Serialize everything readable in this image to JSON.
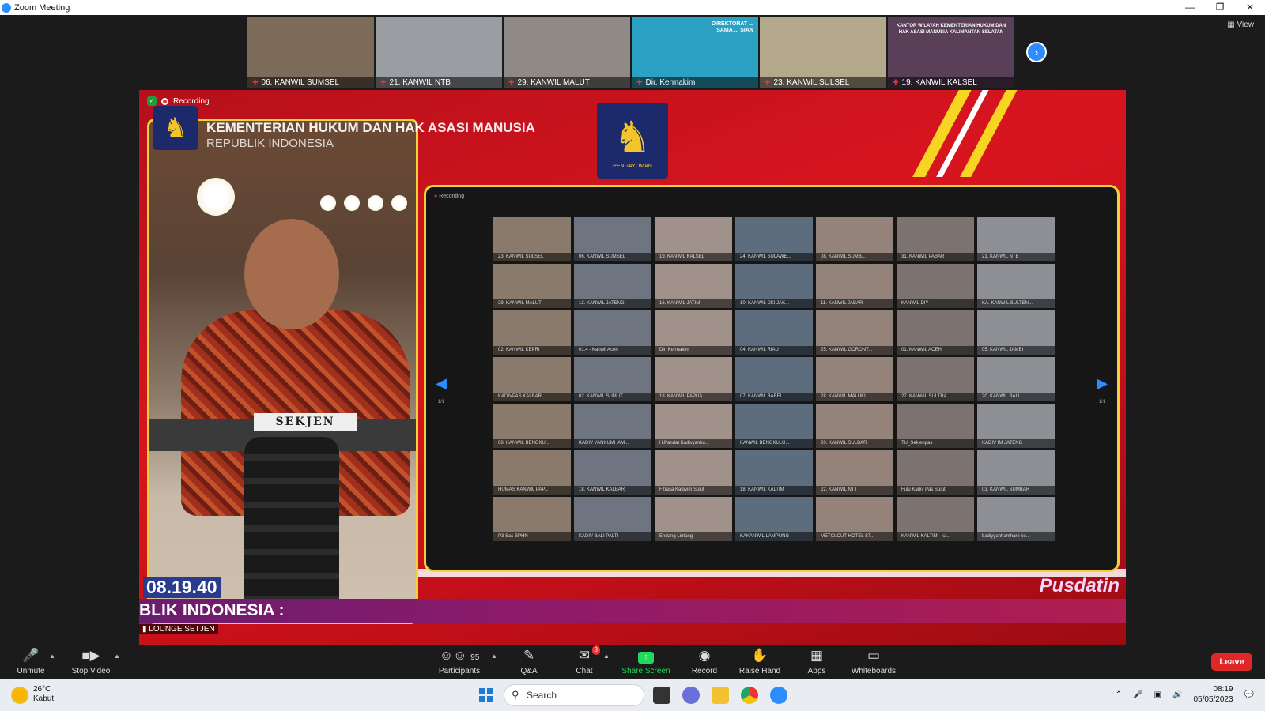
{
  "window": {
    "title": "Zoom Meeting"
  },
  "strip": {
    "thumbs": [
      {
        "label": "06. KANWIL SUMSEL",
        "color": "#7d6b5a"
      },
      {
        "label": "21. KANWIL NTB",
        "color": "#9a9ea3"
      },
      {
        "label": "29. KANWIL MALUT",
        "color": "#8f8a85"
      },
      {
        "label": "Dir. Kermakim",
        "color": "#2ba2c4"
      },
      {
        "label": "23. KANWIL SULSEL",
        "color": "#b3a88c"
      },
      {
        "label": "19. KANWIL KALSEL",
        "color": "#5a3f59"
      }
    ],
    "thumb4_overlay": "DIREKTORAT ... SAMA ... SIAN",
    "thumb6_overlay": "KANTOR WILAYAH KEMENTERIAN HUKUM DAN HAK ASASI MANUSIA KALIMANTAN SELATAN",
    "view_label": "View"
  },
  "share": {
    "recording_label": "Recording",
    "ministry_line1": "KEMENTERIAN HUKUM DAN HAK ASASI MANUSIA",
    "ministry_line2": "REPUBLIK INDONESIA",
    "emblem_caption": "PENGAYOMAN",
    "name_plate": "SEKJEN",
    "clock": "08.19.40",
    "ticker": "BLIK INDONESIA :",
    "room_name": "LOUNGE SETJEN",
    "logo": "Pusdatin",
    "inner_recording": "Recording",
    "inner_page_left": "1/1",
    "inner_page_right": "1/1",
    "grid": [
      "23. KANWIL SULSEL",
      "06. KANWIL SUMSEL",
      "19. KANWIL KALSEL",
      "24. KANWIL SULAWE...",
      "08. KANWIL SUMB...",
      "31. KANWIL PABAR",
      "21. KANWIL NTB",
      "29. KANWIL MALUT",
      "13. KANWIL JATENG",
      "16. KANWIL JATIM",
      "10. KANWIL DKI JAK...",
      "11. KANWIL JABAR",
      "KANWIL DIY",
      "KA. KANWIL SULTEN...",
      "02. KANWIL KEPRI",
      "01.4 - Kanwil Aceh",
      "Dir. Kermakim",
      "04. KANWIL RIAU",
      "25. KANWIL GORONT...",
      "01. KANWIL ACEH",
      "05. KANWIL JAMBI",
      "KADIVPAS KALBAR...",
      "02. KANWIL SUMUT",
      "18. KANWIL PAPUA",
      "07. KANWIL BABEL",
      "28. KANWIL MALUKU",
      "27. KANWIL SULTRA",
      "20. KANWIL BALI",
      "08. KANWIL BENGKU...",
      "KADIV YANKUMHAM...",
      "H.Pandat Kadivyanku...",
      "KANWIL BENGKULU...",
      "20. KANWIL SULBAR",
      "TU_Sekjenpas",
      "KADIV IM JATENG",
      "HUMAS KANWIL PAP...",
      "18. KANWIL KALBAR",
      "Fitrasa Kadivim Sulut",
      "18. KANWIL KALTIM",
      "22. KANWIL NTT",
      "Fulu Kadiv Pas Sulut",
      "03. KANWIL SUMBAR",
      "P3 Sas BPHN",
      "KADIV BALI PALTI",
      "Endang Lintang",
      "KAKANWIL LAMPUNG",
      "METCLOUT HOTEL ST...",
      "KANWIL KALTIM - ka...",
      "badiyyanhamhare ke..."
    ]
  },
  "toolbar": {
    "unmute": "Unmute",
    "stop_video": "Stop Video",
    "participants": "Participants",
    "participants_count": "95",
    "qa": "Q&A",
    "chat": "Chat",
    "chat_badge": "8",
    "share_screen": "Share Screen",
    "record": "Record",
    "raise_hand": "Raise Hand",
    "apps": "Apps",
    "whiteboards": "Whiteboards",
    "leave": "Leave",
    "share_color": "#23d959"
  },
  "taskbar": {
    "temperature": "26°C",
    "weather_text": "Kabut",
    "search_label": "Search",
    "time": "08:19",
    "date": "05/05/2023"
  }
}
